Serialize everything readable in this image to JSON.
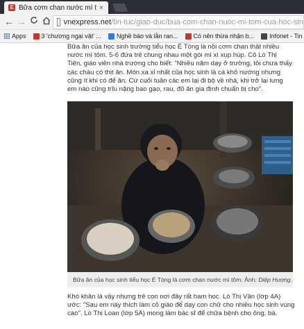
{
  "browser": {
    "tab_title": "Bữa cơm chan nước mì tôm",
    "tab_close": "×",
    "nav": {
      "back": "←",
      "forward": "→",
      "reload": "C",
      "home": "⌂"
    },
    "url_domain": "vnexpress.net",
    "url_path": "/tin-tuc/giao-duc/bua-com-chan-nuoc-mi-tom-cua-hoc-sin"
  },
  "bookmarks": [
    {
      "label": "Apps",
      "icon": "apps-grid-icon"
    },
    {
      "label": "3 'chương ngại vật' ...",
      "icon": "favicon",
      "color": "#c0392b"
    },
    {
      "label": "Nghề báo và lằn ran...",
      "icon": "favicon",
      "color": "#2e7dd8"
    },
    {
      "label": "Có nên thừa nhận b...",
      "icon": "favicon",
      "color": "#c0392b"
    },
    {
      "label": "Infonet - Tin tức -",
      "icon": "favicon",
      "color": "#444"
    }
  ],
  "article": {
    "paragraph1": "Bữa ăn của học sinh trường tiểu học É Tòng là nồi cơm chan thật nhiều nước mì tôm. 5-6 đứa trẻ chung nhau một gói mì xì xụp húp. Cô Lò Thị Tiên, giáo viên nhà trường cho biết: \"Nhiều năm dạy ở trường, tôi chưa thấy các cháu có thịt ăn. Món xa xỉ nhất của học sinh là cá khô nướng nhưng cũng ít khi có để ăn. Cứ cuối tuần các em lại đi bộ về nhà, khi trở lại lưng em nào cũng trĩu nặng bao gạo, rau, đồ ăn gia đình chuẩn bị cho\".",
    "caption_text": "Bữa ăn của học sinh tiểu học É Tòng là cơm chan nước mì tôm. Ảnh: ",
    "caption_credit": "Diệp Hương.",
    "paragraph2": "Khó khăn là vậy nhưng trẻ con nơi đây rất ham học. Lò Thị Vân (lớp 4A) ước: \"Sau em này thích làm cô giáo để dạy con chữ cho nhiều học sinh vùng cao\". Lò Thị Loan (lớp 5A) mong làm bác sĩ để chữa bệnh cho ông, bà."
  },
  "photo": {
    "description_icon": "photo-child-eating-icon"
  }
}
